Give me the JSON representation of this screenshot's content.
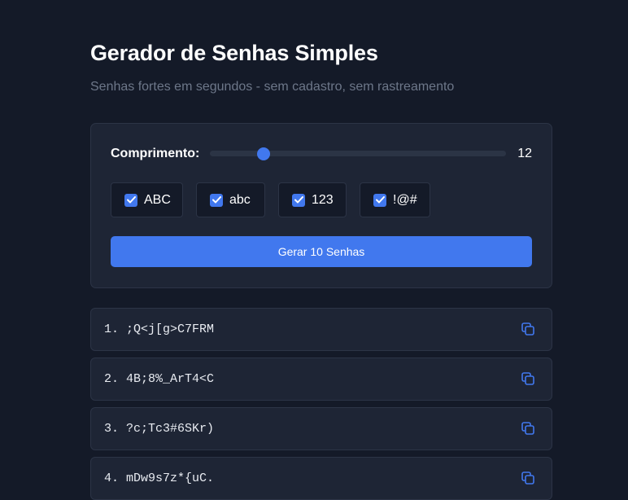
{
  "header": {
    "title": "Gerador de Senhas Simples",
    "subtitle": "Senhas fortes em segundos - sem cadastro, sem rastreamento"
  },
  "settings": {
    "length_label": "Comprimento:",
    "length_value": "12",
    "slider_level": 0.18,
    "options": [
      {
        "label": "ABC",
        "checked": true
      },
      {
        "label": "abc",
        "checked": true
      },
      {
        "label": "123",
        "checked": true
      },
      {
        "label": "!@#",
        "checked": true
      }
    ],
    "generate_label": "Gerar 10 Senhas"
  },
  "passwords": [
    {
      "index": "1.",
      "value": ";Q<j[g>C7FRM"
    },
    {
      "index": "2.",
      "value": "4B;8%_ArT4<C"
    },
    {
      "index": "3.",
      "value": "?c;Tc3#6SKr)"
    },
    {
      "index": "4.",
      "value": "mDw9s7z*{uC."
    }
  ],
  "colors": {
    "background": "#141a28",
    "panel": "#1e2535",
    "accent": "#4178ee",
    "muted_text": "#6d7789"
  },
  "icons": {
    "copy": "copy-icon",
    "checkbox": "checkbox-checked-icon"
  }
}
